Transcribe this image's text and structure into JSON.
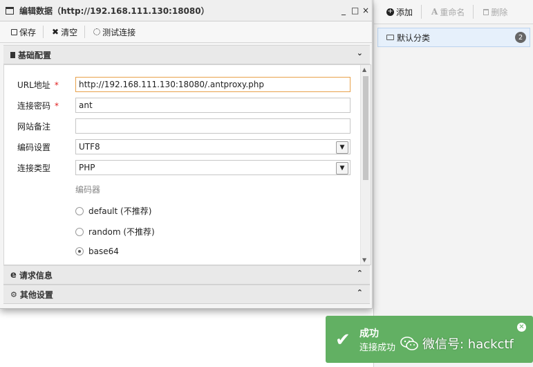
{
  "dialog": {
    "title": "编辑数据（http://192.168.111.130:18080）",
    "controls": [
      "_",
      "□",
      "×"
    ]
  },
  "toolbar": {
    "save_label": "保存",
    "clear_label": "清空",
    "test_label": "测试连接"
  },
  "sections": {
    "basic": "基础配置",
    "request": "请求信息",
    "other": "其他设置"
  },
  "form": {
    "url_label": "URL地址",
    "url_value": "http://192.168.111.130:18080/.antproxy.php",
    "password_label": "连接密码",
    "password_value": "ant",
    "note_label": "网站备注",
    "note_value": "",
    "encoding_label": "编码设置",
    "encoding_value": "UTF8",
    "type_label": "连接类型",
    "type_value": "PHP",
    "required_mark": "*",
    "encoder_label": "编码器",
    "encoders": [
      {
        "label": "default (不推荐)",
        "selected": false
      },
      {
        "label": "random (不推荐)",
        "selected": false
      },
      {
        "label": "base64",
        "selected": true
      }
    ]
  },
  "right_panel": {
    "add_label": "添加",
    "rename_label": "重命名",
    "delete_label": "删除",
    "category_label": "默认分类",
    "category_count": "2"
  },
  "toast": {
    "title": "成功",
    "message": "连接成功",
    "accent": "#62b063"
  },
  "watermark": {
    "text": "微信号: hackctf"
  }
}
